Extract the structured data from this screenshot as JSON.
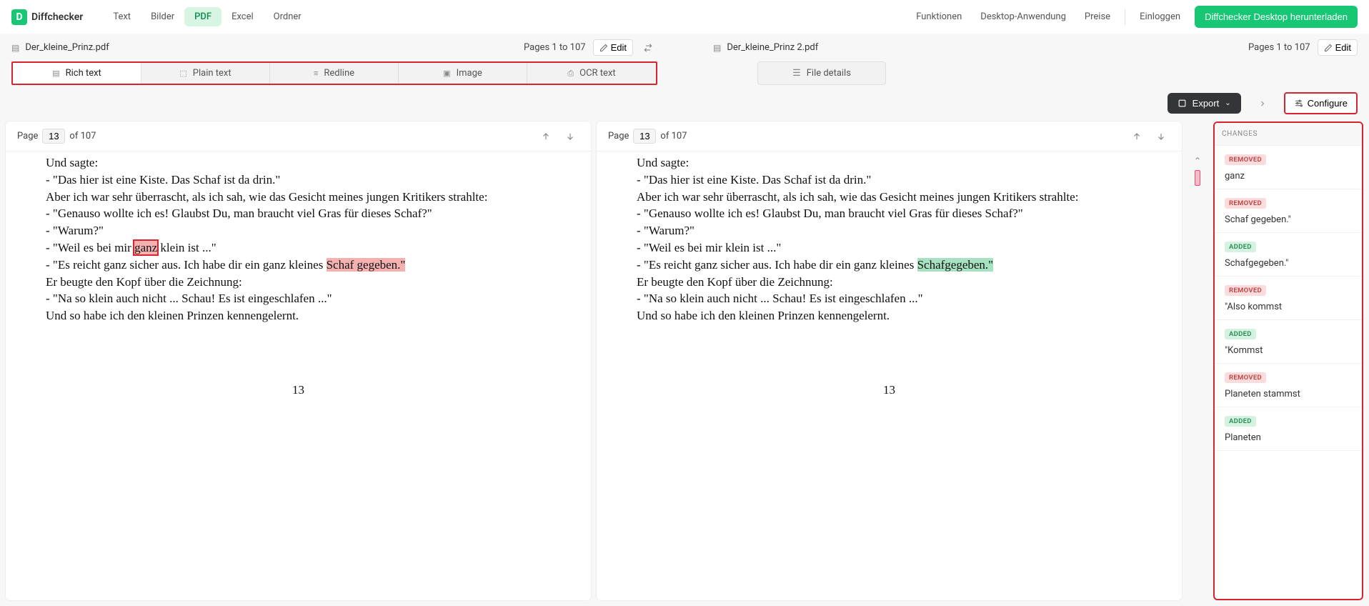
{
  "header": {
    "brand": "Diffchecker",
    "nav": [
      "Text",
      "Bilder",
      "PDF",
      "Excel",
      "Ordner"
    ],
    "nav_active_index": 2,
    "right_links": [
      "Funktionen",
      "Desktop-Anwendung",
      "Preise"
    ],
    "login": "Einloggen",
    "cta": "Diffchecker Desktop herunterladen"
  },
  "files": {
    "left": {
      "name": "Der_kleine_Prinz.pdf",
      "pages": "Pages 1 to 107",
      "edit": "Edit"
    },
    "right": {
      "name": "Der_kleine_Prinz 2.pdf",
      "pages": "Pages 1 to 107",
      "edit": "Edit"
    }
  },
  "tabs": {
    "items": [
      "Rich text",
      "Plain text",
      "Redline",
      "Image",
      "OCR text"
    ],
    "active_index": 0,
    "file_details": "File details"
  },
  "toolbar": {
    "export": "Export",
    "configure": "Configure"
  },
  "panes": {
    "page_label": "Page",
    "of_label": "of 107",
    "current_page": "13",
    "left_doc": {
      "lines": [
        "Und sagte:",
        "- \"Das hier ist eine Kiste. Das Schaf ist da drin.\"",
        "Aber ich war sehr überrascht, als ich sah, wie das Gesicht meines jungen Kritikers strahlte:",
        "- \"Genauso wollte ich es! Glaubst Du, man braucht viel Gras für dieses Schaf?\"",
        "- \"Warum?\"",
        "- \"Weil es bei mir ",
        {
          "t": "ganz",
          "cls": "hl-removed-strong"
        },
        " klein ist ...\"",
        "- \"Es reicht ganz sicher aus. Ich habe dir ein ganz kleines ",
        {
          "t": "Schaf gegeben.\"",
          "cls": "hl-removed"
        },
        "Er beugte den Kopf über die Zeichnung:",
        "- \"Na so klein auch nicht ... Schau! Es ist eingeschlafen ...\"",
        "Und so habe ich den kleinen Prinzen kennengelernt."
      ],
      "page_number": "13"
    },
    "right_doc": {
      "lines": [
        "Und sagte:",
        "- \"Das hier ist eine Kiste. Das Schaf ist da drin.\"",
        "Aber ich war sehr überrascht, als ich sah, wie das Gesicht meines jungen Kritikers strahlte:",
        "- \"Genauso wollte ich es! Glaubst Du, man braucht viel Gras für dieses Schaf?\"",
        "- \"Warum?\"",
        "- \"Weil es bei mir klein ist ...\"",
        "- \"Es reicht ganz sicher aus. Ich habe dir ein ganz kleines ",
        {
          "t": "Schafgegeben.\"",
          "cls": "hl-added"
        },
        "Er beugte den Kopf über die Zeichnung:",
        "- \"Na so klein auch nicht ... Schau! Es ist eingeschlafen ...\"",
        "Und so habe ich den kleinen Prinzen kennengelernt."
      ],
      "page_number": "13"
    }
  },
  "changes": {
    "title": "CHANGES",
    "labels": {
      "removed": "REMOVED",
      "added": "ADDED"
    },
    "items": [
      {
        "type": "removed",
        "text": "ganz"
      },
      {
        "type": "removed",
        "text": "Schaf gegeben.\""
      },
      {
        "type": "added",
        "text": "Schafgegeben.\""
      },
      {
        "type": "removed",
        "text": "\"Also kommst"
      },
      {
        "type": "added",
        "text": "\"Kommst"
      },
      {
        "type": "removed",
        "text": "Planeten stammst"
      },
      {
        "type": "added",
        "text": "Planeten"
      }
    ]
  }
}
